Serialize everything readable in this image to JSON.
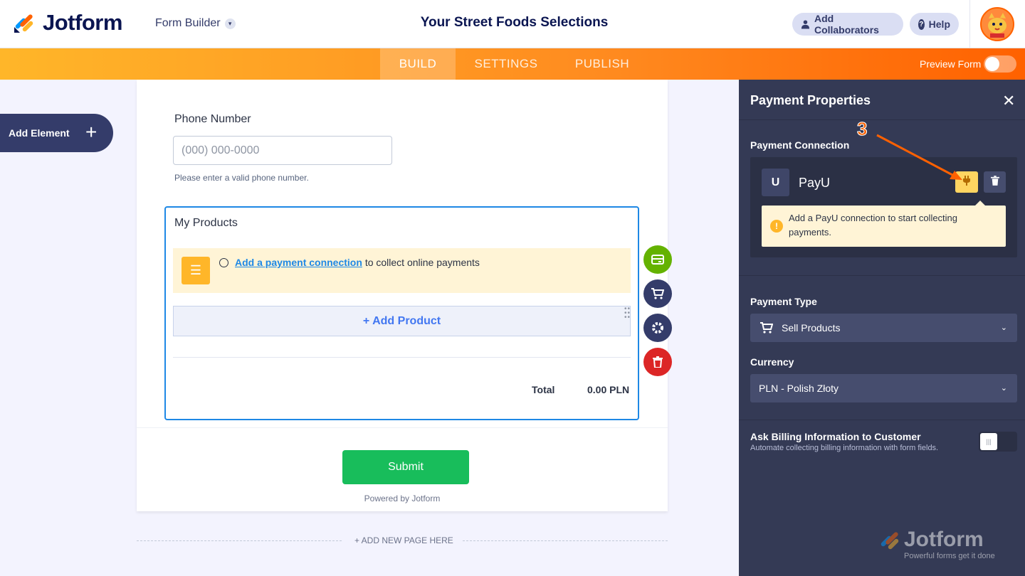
{
  "header": {
    "brand": "Jotform",
    "builder_label": "Form Builder",
    "form_title": "Your Street Foods Selections",
    "collaborators_label": "Add Collaborators",
    "help_label": "Help"
  },
  "nav": {
    "tabs": [
      {
        "label": "BUILD"
      },
      {
        "label": "SETTINGS"
      },
      {
        "label": "PUBLISH"
      }
    ],
    "preview_label": "Preview Form"
  },
  "add_element": {
    "label": "Add Element"
  },
  "form": {
    "phone": {
      "label": "Phone Number",
      "placeholder": "(000) 000-0000",
      "hint": "Please enter a valid phone number."
    },
    "products": {
      "title": "My Products",
      "notice_link": "Add a payment connection",
      "notice_rest": "to collect online payments",
      "add_product": "+ Add Product",
      "total_label": "Total",
      "total_value": "0.00 PLN"
    },
    "submit_label": "Submit",
    "powered": "Powered by Jotform",
    "add_page": "+ ADD NEW PAGE HERE"
  },
  "panel": {
    "title": "Payment Properties",
    "connection_label": "Payment Connection",
    "gateway": {
      "logo": "U",
      "name": "PayU"
    },
    "warning": "Add a PayU connection to start collecting payments.",
    "payment_type_label": "Payment Type",
    "payment_type_value": "Sell Products",
    "currency_label": "Currency",
    "currency_value": "PLN - Polish Złoty",
    "billing_title": "Ask Billing Information to Customer",
    "billing_sub": "Automate collecting billing information with form fields.",
    "watermark": "Jotform",
    "watermark_sub": "Powerful forms get it done"
  },
  "annotation": {
    "step": "3",
    "color": "#ff6100"
  },
  "colors": {
    "accent": "#ff6100",
    "panel_bg": "#343a55",
    "submit": "#18bd5b",
    "link": "#1e88e5"
  }
}
